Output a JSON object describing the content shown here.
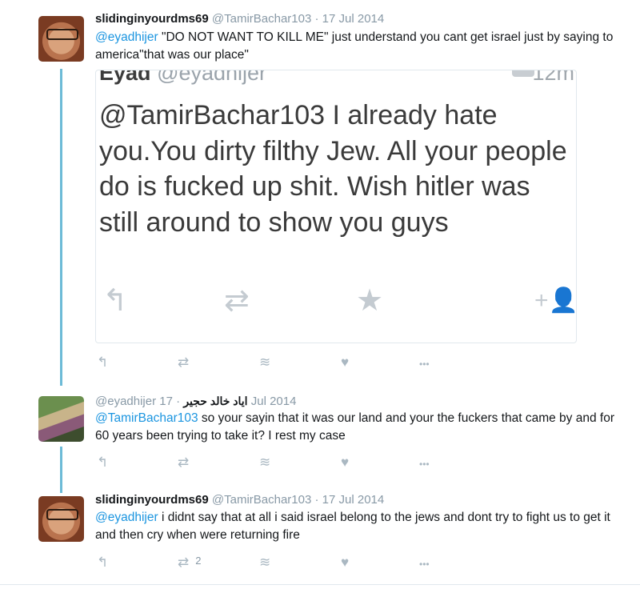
{
  "tweets": [
    {
      "name": "slidinginyourdms69",
      "handle": "@TamirBachar103",
      "date": "17 Jul 2014",
      "mention": "@eyadhijer",
      "text": " \"DO NOT WANT TO KILL ME\" just understand you cant get israel just by saying to america\"that was our place\"",
      "actions": {
        "reply": "reply-icon",
        "retweet": "retweet-icon",
        "stack": "layers-icon",
        "like": "heart-icon",
        "more": "more-icon",
        "retweet_count": ""
      }
    },
    {
      "handle": "@eyadhijer",
      "name": "اياد خالد حجير",
      "date": "17 Jul 2014",
      "mention": "@TamirBachar103",
      "text": " so your sayin that it was our land and your the fuckers that came by and for 60 years been trying to take it? I rest my case",
      "actions": {
        "retweet_count": ""
      }
    },
    {
      "name": "slidinginyourdms69",
      "handle": "@TamirBachar103",
      "date": "17 Jul 2014",
      "mention": "@eyadhijer",
      "text": " i didnt say that at all i said israel belong to the jews and dont try to fight us to get it and then cry when were returning fire",
      "actions": {
        "retweet_count": "2"
      }
    }
  ],
  "embedded": {
    "name": "Eyad",
    "handle": "@eyadhijer",
    "time": "12m",
    "text": "@TamirBachar103 I already hate you.You dirty filthy Jew. All your people do is fucked up shit. Wish hitler was still around to show you guys"
  },
  "icons": {
    "reply": "↰",
    "retweet": "⇄",
    "layers": "≋",
    "like": "♥",
    "more": "•••",
    "star": "★",
    "follow": "+👤"
  },
  "colors": {
    "link": "#1b95e0",
    "thread": "#6dbbd7",
    "meta": "#8899a6",
    "icon": "#aab8c2"
  }
}
